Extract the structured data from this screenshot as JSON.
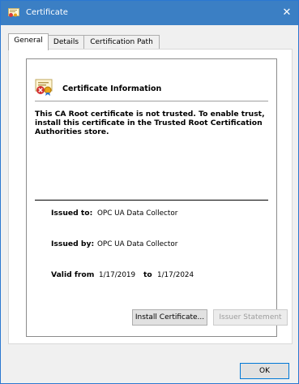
{
  "window": {
    "title": "Certificate"
  },
  "tabs": [
    {
      "label": "General"
    },
    {
      "label": "Details"
    },
    {
      "label": "Certification Path"
    }
  ],
  "cert": {
    "heading": "Certificate Information",
    "warning": "This CA Root certificate is not trusted. To enable trust, install this certificate in the Trusted Root Certification Authorities store.",
    "issued_to_label": "Issued to:",
    "issued_to": "OPC UA Data Collector",
    "issued_by_label": "Issued by:",
    "issued_by": "OPC UA Data Collector",
    "valid_from_label": "Valid from",
    "valid_from": "1/17/2019",
    "to_label": "to",
    "valid_to": "1/17/2024"
  },
  "buttons": {
    "install": "Install Certificate...",
    "issuer": "Issuer Statement",
    "ok": "OK"
  }
}
